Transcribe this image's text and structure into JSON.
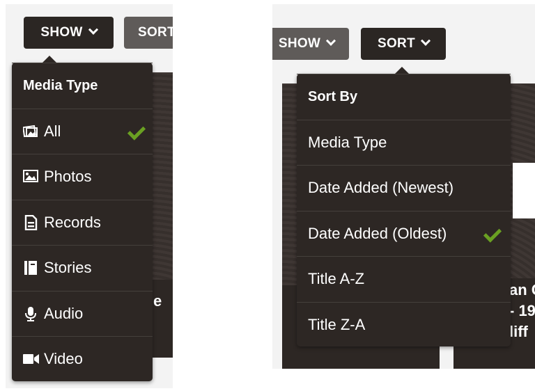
{
  "left": {
    "show_button": "SHOW",
    "sort_button_partial": "SORT",
    "menu": {
      "header": "Media Type",
      "items": [
        {
          "label": "All",
          "icon": "photos-stack-icon",
          "selected": true
        },
        {
          "label": "Photos",
          "icon": "photo-icon",
          "selected": false
        },
        {
          "label": "Records",
          "icon": "document-icon",
          "selected": false
        },
        {
          "label": "Stories",
          "icon": "book-icon",
          "selected": false
        },
        {
          "label": "Audio",
          "icon": "microphone-icon",
          "selected": false
        },
        {
          "label": "Video",
          "icon": "video-camera-icon",
          "selected": false
        }
      ]
    },
    "bg_partial_text": "e"
  },
  "right": {
    "show_button_partial": "SHOW",
    "sort_button": "SORT",
    "menu": {
      "header": "Sort By",
      "items": [
        {
          "label": "Media Type",
          "selected": false
        },
        {
          "label": "Date Added (Newest)",
          "selected": false
        },
        {
          "label": "Date Added (Oldest)",
          "selected": true
        },
        {
          "label": "Title A-Z",
          "selected": false
        },
        {
          "label": "Title Z-A",
          "selected": false
        }
      ]
    },
    "bg_partial_text": {
      "line1": "an C",
      "line2": "- 19",
      "line3": "liff"
    }
  },
  "colors": {
    "accent_check": "#6aa022",
    "menu_bg": "#2d2724",
    "button_dark": "#2b2623",
    "button_grey": "#5f5b59"
  }
}
